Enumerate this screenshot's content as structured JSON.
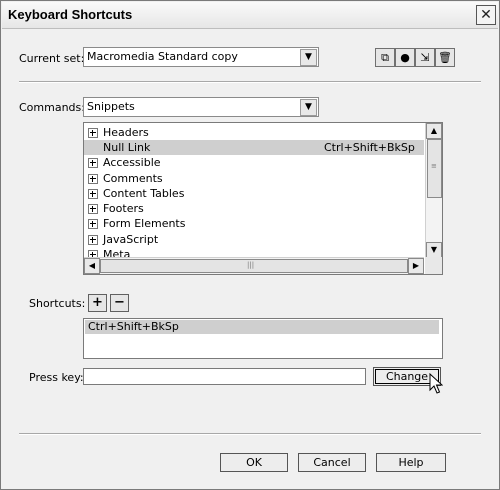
{
  "window": {
    "title": "Keyboard Shortcuts",
    "close_icon": "close-icon"
  },
  "current_set": {
    "label": "Current set:",
    "value": "Macromedia Standard copy"
  },
  "toolbar": {
    "icons": [
      "duplicate-set-icon",
      "rename-set-icon",
      "export-set-icon",
      "delete-set-icon"
    ]
  },
  "commands": {
    "label": "Commands:",
    "value": "Snippets"
  },
  "command_list": {
    "items": [
      {
        "label": "Headers",
        "shortcut": "",
        "expandable": true,
        "selected": false
      },
      {
        "label": "Null Link",
        "shortcut": "Ctrl+Shift+BkSp",
        "expandable": false,
        "selected": true
      },
      {
        "label": "Accessible",
        "shortcut": "",
        "expandable": true,
        "selected": false
      },
      {
        "label": "Comments",
        "shortcut": "",
        "expandable": true,
        "selected": false
      },
      {
        "label": "Content Tables",
        "shortcut": "",
        "expandable": true,
        "selected": false
      },
      {
        "label": "Footers",
        "shortcut": "",
        "expandable": true,
        "selected": false
      },
      {
        "label": "Form Elements",
        "shortcut": "",
        "expandable": true,
        "selected": false
      },
      {
        "label": "JavaScript",
        "shortcut": "",
        "expandable": true,
        "selected": false
      },
      {
        "label": "Meta",
        "shortcut": "",
        "expandable": true,
        "selected": false
      }
    ]
  },
  "shortcuts": {
    "label": "Shortcuts:",
    "add_label": "+",
    "remove_label": "−",
    "items": [
      "Ctrl+Shift+BkSp"
    ]
  },
  "press_key": {
    "label": "Press key:",
    "value": "",
    "change_label": "Change"
  },
  "footer": {
    "ok_label": "OK",
    "cancel_label": "Cancel",
    "help_label": "Help"
  }
}
